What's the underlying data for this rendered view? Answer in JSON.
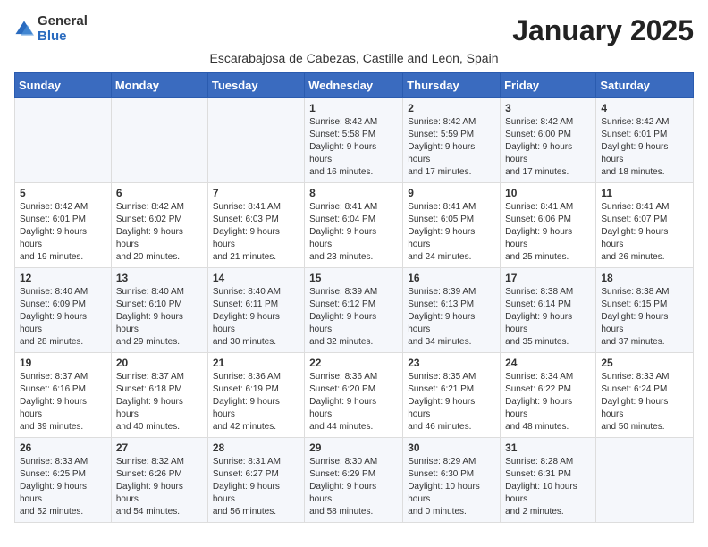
{
  "logo": {
    "text_general": "General",
    "text_blue": "Blue"
  },
  "header": {
    "title": "January 2025",
    "subtitle": "Escarabajosa de Cabezas, Castille and Leon, Spain"
  },
  "days_of_week": [
    "Sunday",
    "Monday",
    "Tuesday",
    "Wednesday",
    "Thursday",
    "Friday",
    "Saturday"
  ],
  "weeks": [
    [
      {
        "day": "",
        "info": ""
      },
      {
        "day": "",
        "info": ""
      },
      {
        "day": "",
        "info": ""
      },
      {
        "day": "1",
        "info": "Sunrise: 8:42 AM\nSunset: 5:58 PM\nDaylight: 9 hours and 16 minutes."
      },
      {
        "day": "2",
        "info": "Sunrise: 8:42 AM\nSunset: 5:59 PM\nDaylight: 9 hours and 17 minutes."
      },
      {
        "day": "3",
        "info": "Sunrise: 8:42 AM\nSunset: 6:00 PM\nDaylight: 9 hours and 17 minutes."
      },
      {
        "day": "4",
        "info": "Sunrise: 8:42 AM\nSunset: 6:01 PM\nDaylight: 9 hours and 18 minutes."
      }
    ],
    [
      {
        "day": "5",
        "info": "Sunrise: 8:42 AM\nSunset: 6:01 PM\nDaylight: 9 hours and 19 minutes."
      },
      {
        "day": "6",
        "info": "Sunrise: 8:42 AM\nSunset: 6:02 PM\nDaylight: 9 hours and 20 minutes."
      },
      {
        "day": "7",
        "info": "Sunrise: 8:41 AM\nSunset: 6:03 PM\nDaylight: 9 hours and 21 minutes."
      },
      {
        "day": "8",
        "info": "Sunrise: 8:41 AM\nSunset: 6:04 PM\nDaylight: 9 hours and 23 minutes."
      },
      {
        "day": "9",
        "info": "Sunrise: 8:41 AM\nSunset: 6:05 PM\nDaylight: 9 hours and 24 minutes."
      },
      {
        "day": "10",
        "info": "Sunrise: 8:41 AM\nSunset: 6:06 PM\nDaylight: 9 hours and 25 minutes."
      },
      {
        "day": "11",
        "info": "Sunrise: 8:41 AM\nSunset: 6:07 PM\nDaylight: 9 hours and 26 minutes."
      }
    ],
    [
      {
        "day": "12",
        "info": "Sunrise: 8:40 AM\nSunset: 6:09 PM\nDaylight: 9 hours and 28 minutes."
      },
      {
        "day": "13",
        "info": "Sunrise: 8:40 AM\nSunset: 6:10 PM\nDaylight: 9 hours and 29 minutes."
      },
      {
        "day": "14",
        "info": "Sunrise: 8:40 AM\nSunset: 6:11 PM\nDaylight: 9 hours and 30 minutes."
      },
      {
        "day": "15",
        "info": "Sunrise: 8:39 AM\nSunset: 6:12 PM\nDaylight: 9 hours and 32 minutes."
      },
      {
        "day": "16",
        "info": "Sunrise: 8:39 AM\nSunset: 6:13 PM\nDaylight: 9 hours and 34 minutes."
      },
      {
        "day": "17",
        "info": "Sunrise: 8:38 AM\nSunset: 6:14 PM\nDaylight: 9 hours and 35 minutes."
      },
      {
        "day": "18",
        "info": "Sunrise: 8:38 AM\nSunset: 6:15 PM\nDaylight: 9 hours and 37 minutes."
      }
    ],
    [
      {
        "day": "19",
        "info": "Sunrise: 8:37 AM\nSunset: 6:16 PM\nDaylight: 9 hours and 39 minutes."
      },
      {
        "day": "20",
        "info": "Sunrise: 8:37 AM\nSunset: 6:18 PM\nDaylight: 9 hours and 40 minutes."
      },
      {
        "day": "21",
        "info": "Sunrise: 8:36 AM\nSunset: 6:19 PM\nDaylight: 9 hours and 42 minutes."
      },
      {
        "day": "22",
        "info": "Sunrise: 8:36 AM\nSunset: 6:20 PM\nDaylight: 9 hours and 44 minutes."
      },
      {
        "day": "23",
        "info": "Sunrise: 8:35 AM\nSunset: 6:21 PM\nDaylight: 9 hours and 46 minutes."
      },
      {
        "day": "24",
        "info": "Sunrise: 8:34 AM\nSunset: 6:22 PM\nDaylight: 9 hours and 48 minutes."
      },
      {
        "day": "25",
        "info": "Sunrise: 8:33 AM\nSunset: 6:24 PM\nDaylight: 9 hours and 50 minutes."
      }
    ],
    [
      {
        "day": "26",
        "info": "Sunrise: 8:33 AM\nSunset: 6:25 PM\nDaylight: 9 hours and 52 minutes."
      },
      {
        "day": "27",
        "info": "Sunrise: 8:32 AM\nSunset: 6:26 PM\nDaylight: 9 hours and 54 minutes."
      },
      {
        "day": "28",
        "info": "Sunrise: 8:31 AM\nSunset: 6:27 PM\nDaylight: 9 hours and 56 minutes."
      },
      {
        "day": "29",
        "info": "Sunrise: 8:30 AM\nSunset: 6:29 PM\nDaylight: 9 hours and 58 minutes."
      },
      {
        "day": "30",
        "info": "Sunrise: 8:29 AM\nSunset: 6:30 PM\nDaylight: 10 hours and 0 minutes."
      },
      {
        "day": "31",
        "info": "Sunrise: 8:28 AM\nSunset: 6:31 PM\nDaylight: 10 hours and 2 minutes."
      },
      {
        "day": "",
        "info": ""
      }
    ]
  ]
}
